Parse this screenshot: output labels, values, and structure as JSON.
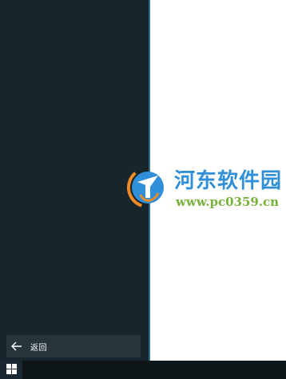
{
  "start_menu": {
    "back_button": {
      "icon": "arrow-left-icon",
      "label": "返回"
    }
  },
  "taskbar": {
    "start_icon": "windows-logo-icon"
  },
  "watermark": {
    "title": "河东软件园",
    "url": "www.pc0359.cn",
    "colors": {
      "title": "#2f8fd8",
      "url": "#78b23a",
      "logo_blue": "#2f8fd8",
      "logo_orange": "#f08a24"
    }
  },
  "colors": {
    "panel_bg": "#17252d",
    "taskbar_bg": "#0d1519",
    "accent_edge": "#2f6f86",
    "desktop_bg": "#ffffff"
  }
}
